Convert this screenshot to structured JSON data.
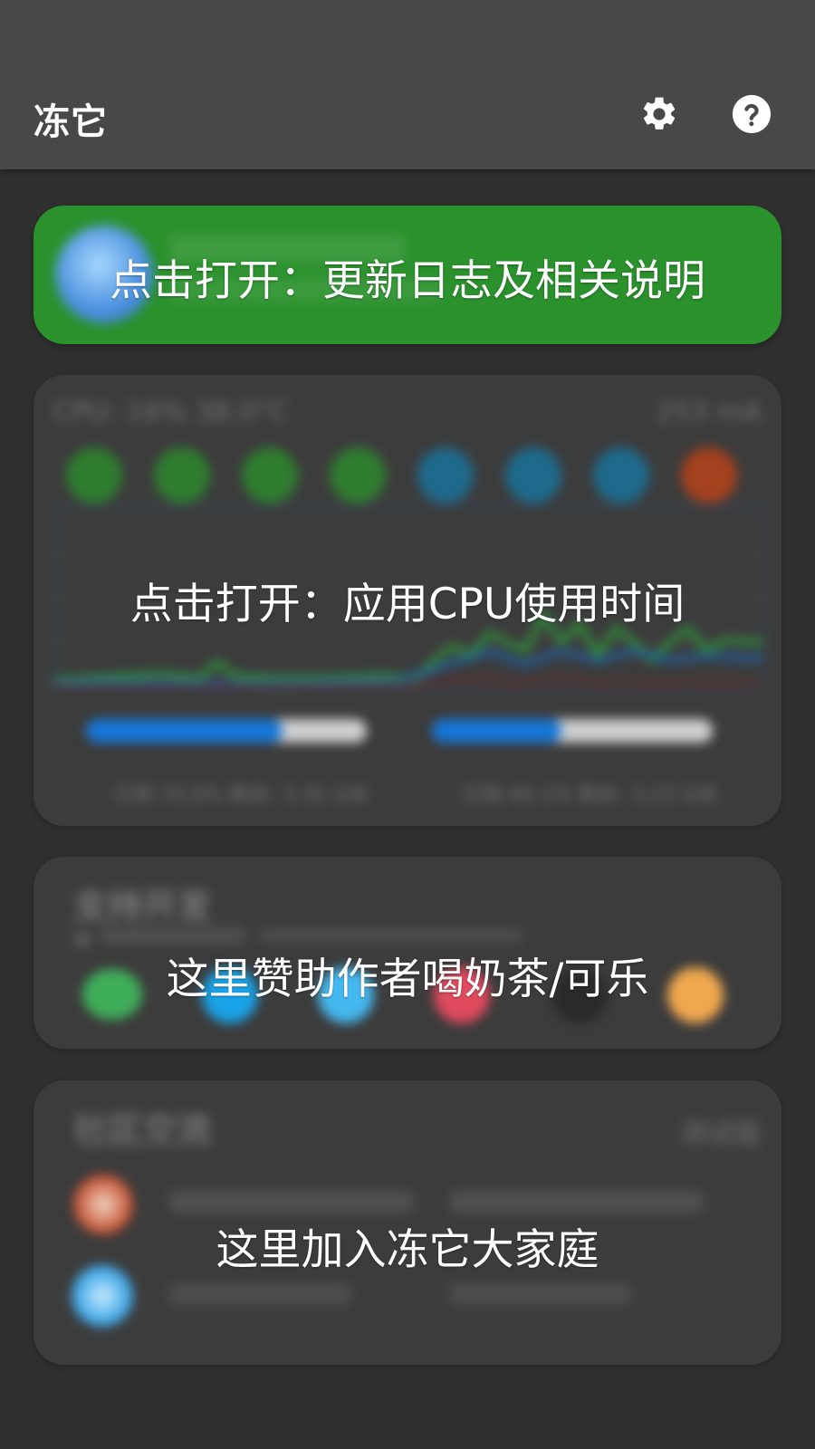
{
  "app": {
    "title": "冻它"
  },
  "toolbar": {
    "settings_icon": "gear-icon",
    "help_icon": "help-icon"
  },
  "cards": {
    "changelog": {
      "overlay": "点击打开：更新日志及相关说明",
      "bg_color": "#2a912c"
    },
    "cpu": {
      "overlay": "点击打开：应用CPU使用时间",
      "cpu_label": "CPU: 16%  38.0°C",
      "current_label": "253 mA",
      "mem_left": {
        "used_fraction": 0.7,
        "text": "已用:70.0% 剩余: 3.35 GiB"
      },
      "mem_right": {
        "used_fraction": 0.461,
        "text": "已用:46.1% 剩余: 3.23 GiB"
      },
      "core_colors": [
        "#2f7d2f",
        "#2f7d2f",
        "#2f7d2f",
        "#2f7d2f",
        "#1e6a8c",
        "#1e6a8c",
        "#1e6a8c",
        "#a5411e"
      ]
    },
    "support": {
      "overlay": "这里赞助作者喝奶茶/可乐",
      "title": "支持开发",
      "subtitle": "模",
      "icon_colors": [
        "#3fae5a",
        "#1aa3e8",
        "#45b8f0",
        "#e04a5e",
        "#2a2a2a",
        "#f0a850"
      ]
    },
    "community": {
      "overlay": "这里加入冻它大家庭",
      "title": "社区交流",
      "right_label": "测试版"
    }
  }
}
